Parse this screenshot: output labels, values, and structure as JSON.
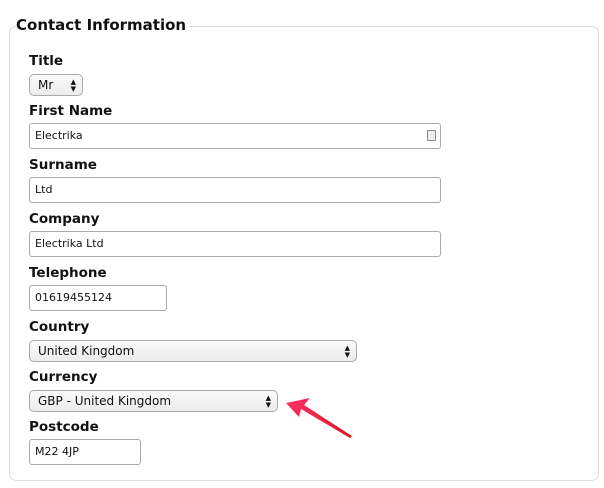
{
  "section_title": "Contact Information",
  "fields": {
    "title": {
      "label": "Title",
      "value": "Mr"
    },
    "first_name": {
      "label": "First Name",
      "value": "Electrika"
    },
    "surname": {
      "label": "Surname",
      "value": "Ltd"
    },
    "company": {
      "label": "Company",
      "value": "Electrika Ltd"
    },
    "telephone": {
      "label": "Telephone",
      "value": "01619455124"
    },
    "country": {
      "label": "Country",
      "value": "United Kingdom"
    },
    "currency": {
      "label": "Currency",
      "value": "GBP - United Kingdom"
    },
    "postcode": {
      "label": "Postcode",
      "value": "M22 4JP"
    }
  },
  "colors": {
    "arrow": "#e8252c"
  }
}
